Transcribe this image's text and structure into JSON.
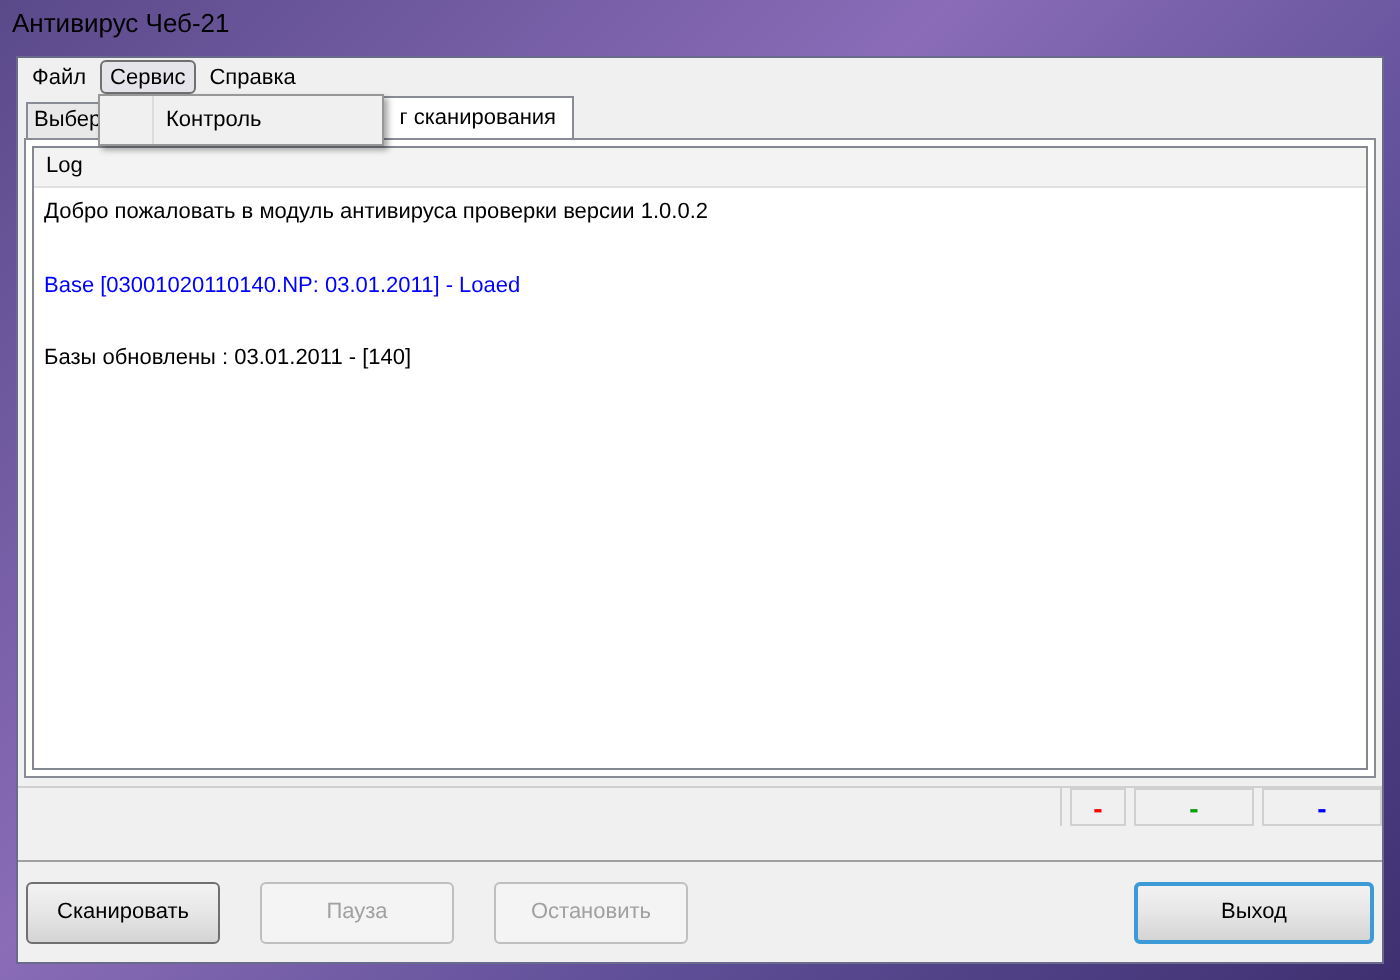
{
  "window": {
    "title": "Антивирус Чеб-21"
  },
  "menu": [
    {
      "label": "Файл",
      "open": false
    },
    {
      "label": "Сервис",
      "open": true,
      "items": [
        "Контроль"
      ]
    },
    {
      "label": "Справка",
      "open": false
    }
  ],
  "tabs": [
    {
      "label": "Выбер",
      "selected": false
    },
    {
      "label": "г сканирования",
      "selected": true
    }
  ],
  "log": {
    "header": "Log",
    "lines": [
      {
        "text": "Добро пожаловать в модуль антивируса проверки версии 1.0.0.2",
        "color": "#000000"
      },
      {
        "text": "Base [03001020110140.NP: 03.01.2011] - Loaed",
        "color": "#0000ff"
      },
      {
        "text": "Базы обновлены : 03.01.2011 - [140]",
        "color": "#000000"
      }
    ]
  },
  "status_bar": [
    {
      "text": "-",
      "color": "#ff0000"
    },
    {
      "text": "-",
      "color": "#00a000"
    },
    {
      "text": "-",
      "color": "#0000ff"
    }
  ],
  "buttons": [
    {
      "label": "Сканировать",
      "disabled": false,
      "default": false
    },
    {
      "label": "Пауза",
      "disabled": true,
      "default": false
    },
    {
      "label": "Остановить",
      "disabled": true,
      "default": false
    },
    {
      "label": "Выход",
      "disabled": false,
      "default": true
    }
  ]
}
